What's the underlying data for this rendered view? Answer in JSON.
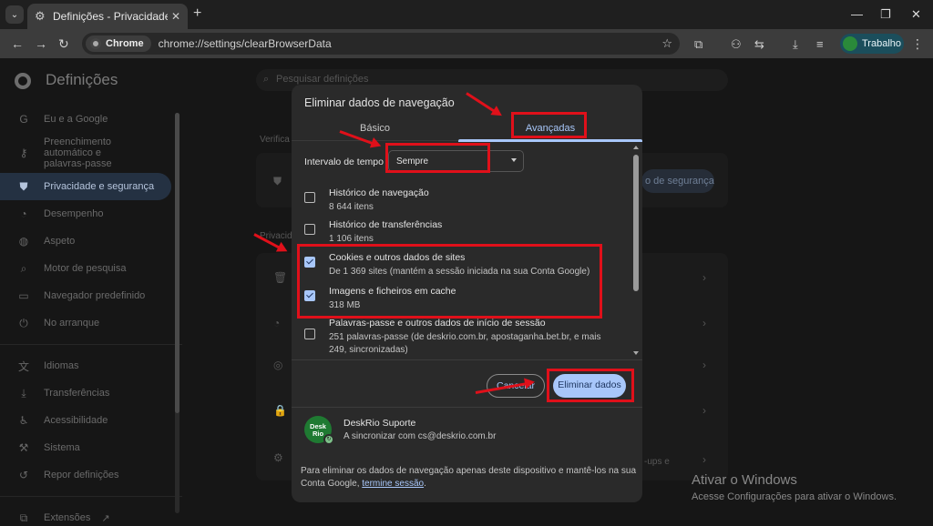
{
  "browser": {
    "tab_title": "Definições - Privacidade e segu",
    "new_tab": "+",
    "url_chip": "Chrome",
    "url": "chrome://settings/clearBrowserData",
    "profile_label": "Trabalho"
  },
  "settings": {
    "title": "Definições",
    "search_placeholder": "Pesquisar definições",
    "sidebar": [
      {
        "label": "Eu e a Google",
        "icon": "google-icon"
      },
      {
        "label": "Preenchimento automático e palavras-passe",
        "icon": "key-icon"
      },
      {
        "label": "Privacidade e segurança",
        "icon": "shield-icon",
        "active": true
      },
      {
        "label": "Desempenho",
        "icon": "speedometer-icon"
      },
      {
        "label": "Aspeto",
        "icon": "palette-icon"
      },
      {
        "label": "Motor de pesquisa",
        "icon": "search-icon"
      },
      {
        "label": "Navegador predefinido",
        "icon": "browser-icon"
      },
      {
        "label": "No arranque",
        "icon": "power-icon"
      },
      {
        "label": "Idiomas",
        "icon": "translate-icon"
      },
      {
        "label": "Transferências",
        "icon": "download-icon"
      },
      {
        "label": "Acessibilidade",
        "icon": "accessibility-icon"
      },
      {
        "label": "Sistema",
        "icon": "wrench-icon"
      },
      {
        "label": "Repor definições",
        "icon": "reset-icon"
      },
      {
        "label": "Extensões",
        "icon": "puzzle-icon"
      }
    ],
    "bg_heading_1": "Verifica",
    "bg_heading_2": "Privacid",
    "bg_button": "o de segurança",
    "bg_snippet": "-ups e"
  },
  "dialog": {
    "title": "Eliminar dados de navegação",
    "tab_basic": "Básico",
    "tab_advanced": "Avançadas",
    "time_range_label": "Intervalo de tempo",
    "time_range_value": "Sempre",
    "options": [
      {
        "title": "Histórico de navegação",
        "desc": "8 644 itens",
        "checked": false
      },
      {
        "title": "Histórico de transferências",
        "desc": "1 106 itens",
        "checked": false
      },
      {
        "title": "Cookies e outros dados de sites",
        "desc": "De 1 369 sites (mantém a sessão iniciada na sua Conta Google)",
        "checked": true
      },
      {
        "title": "Imagens e ficheiros em cache",
        "desc": "318 MB",
        "checked": true
      },
      {
        "title": "Palavras-passe e outros dados de início de sessão",
        "desc": "251 palavras-passe (de deskrio.com.br, apostaganha.bet.br, e mais 249, sincronizadas)",
        "checked": false
      }
    ],
    "cancel_label": "Cancelar",
    "confirm_label": "Eliminar dados",
    "account_avatar_text": "Desk Rio",
    "account_name": "DeskRio Suporte",
    "account_sync": "A sincronizar com cs@deskrio.com.br",
    "footnote_text": "Para eliminar os dados de navegação apenas deste dispositivo e mantê-los na sua Conta Google, ",
    "footnote_link": "termine sessão",
    "footnote_end": "."
  },
  "watermark": {
    "line1": "Ativar o Windows",
    "line2": "Acesse Configurações para ativar o Windows."
  },
  "colors": {
    "accent": "#a8c7fa",
    "annotation": "#e0101a",
    "dialog_bg": "#2a2a2a"
  }
}
